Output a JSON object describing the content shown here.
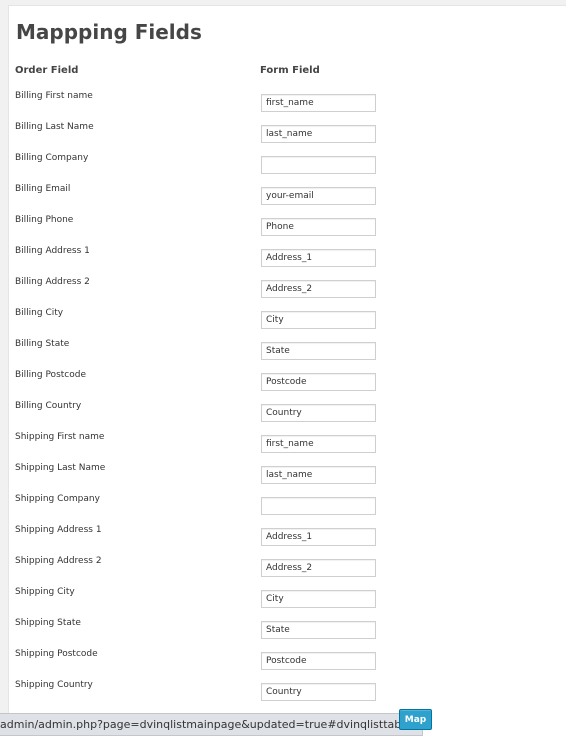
{
  "page": {
    "title": "Mappping Fields",
    "column_order": "Order Field",
    "column_form": "Form Field"
  },
  "rows": [
    {
      "label": "Billing First name",
      "value": "first_name"
    },
    {
      "label": "Billing Last Name",
      "value": "last_name"
    },
    {
      "label": "Billing Company",
      "value": ""
    },
    {
      "label": "Billing Email",
      "value": "your-email"
    },
    {
      "label": "Billing Phone",
      "value": "Phone"
    },
    {
      "label": "Billing Address 1",
      "value": "Address_1"
    },
    {
      "label": "Billing Address 2",
      "value": "Address_2"
    },
    {
      "label": "Billing City",
      "value": "City"
    },
    {
      "label": "Billing State",
      "value": "State"
    },
    {
      "label": "Billing Postcode",
      "value": "Postcode"
    },
    {
      "label": "Billing Country",
      "value": "Country"
    },
    {
      "label": "Shipping First name",
      "value": "first_name"
    },
    {
      "label": "Shipping Last Name",
      "value": "last_name"
    },
    {
      "label": "Shipping Company",
      "value": ""
    },
    {
      "label": "Shipping Address 1",
      "value": "Address_1"
    },
    {
      "label": "Shipping Address 2",
      "value": "Address_2"
    },
    {
      "label": "Shipping City",
      "value": "City"
    },
    {
      "label": "Shipping State",
      "value": "State"
    },
    {
      "label": "Shipping Postcode",
      "value": "Postcode"
    },
    {
      "label": "Shipping Country",
      "value": "Country"
    }
  ],
  "actions": {
    "map_label": "Map"
  },
  "status_bar": {
    "url": "admin/admin.php?page=dvinqlistmainpage&updated=true#dvinqlisttabs-3"
  },
  "colors": {
    "button_bg": "#2ea2cc",
    "page_bg": "#f1f1f1",
    "panel_bg": "#ffffff"
  }
}
